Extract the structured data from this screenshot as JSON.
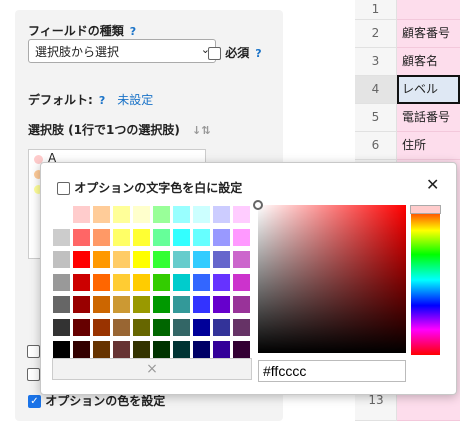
{
  "form": {
    "field_type_label": "フィールドの種類",
    "help_mark": "?",
    "field_type_value": "選択肢から選択",
    "required_label": "必須",
    "default_label": "デフォルト:",
    "default_value": "未設定",
    "options_label": "選択肢 (1行で1つの選択肢)",
    "sort_icon": "↓ª",
    "first_option": "A",
    "option_color_label": "オプションの色を設定"
  },
  "sheet": {
    "rows": [
      {
        "num": "1",
        "value": ""
      },
      {
        "num": "2",
        "value": "顧客番号"
      },
      {
        "num": "3",
        "value": "顧客名"
      },
      {
        "num": "4",
        "value": "レベル"
      },
      {
        "num": "5",
        "value": "電話番号"
      },
      {
        "num": "6",
        "value": "住所"
      }
    ],
    "last_row_num": "13"
  },
  "picker": {
    "white_text_label": "オプションの文字色を白に設定",
    "close_symbol": "✕",
    "clear_symbol": "×",
    "hex_value": "#ffcccc",
    "palette": [
      [
        "#ffffff",
        "#ffcccc",
        "#ffcc99",
        "#ffff99",
        "#ffffcc",
        "#99ff99",
        "#99ffff",
        "#ccffff",
        "#ccccff",
        "#ffccff"
      ],
      [
        "#cccccc",
        "#ff6666",
        "#ff9966",
        "#ffff66",
        "#ffff33",
        "#66ff99",
        "#33ffff",
        "#66ffff",
        "#9999ff",
        "#ff99ff"
      ],
      [
        "#c0c0c0",
        "#ff0000",
        "#ff9900",
        "#ffcc66",
        "#ffff00",
        "#33ff33",
        "#66cccc",
        "#33ccff",
        "#6666cc",
        "#cc66cc"
      ],
      [
        "#999999",
        "#cc0000",
        "#ff6600",
        "#ffcc33",
        "#ffcc00",
        "#33cc00",
        "#00cccc",
        "#3366ff",
        "#6633ff",
        "#cc33cc"
      ],
      [
        "#666666",
        "#990000",
        "#cc6600",
        "#cc9933",
        "#999900",
        "#009900",
        "#339999",
        "#3333ff",
        "#6600cc",
        "#993399"
      ],
      [
        "#333333",
        "#660000",
        "#993300",
        "#996633",
        "#666600",
        "#006600",
        "#336666",
        "#000099",
        "#333399",
        "#663366"
      ],
      [
        "#000000",
        "#330000",
        "#663300",
        "#663333",
        "#333300",
        "#003300",
        "#003333",
        "#000066",
        "#330099",
        "#330033"
      ]
    ]
  },
  "colors": {
    "accent": "#1a73c8",
    "cell_bg": "#fdddec",
    "active_cell_bg": "#dfe8f4"
  }
}
